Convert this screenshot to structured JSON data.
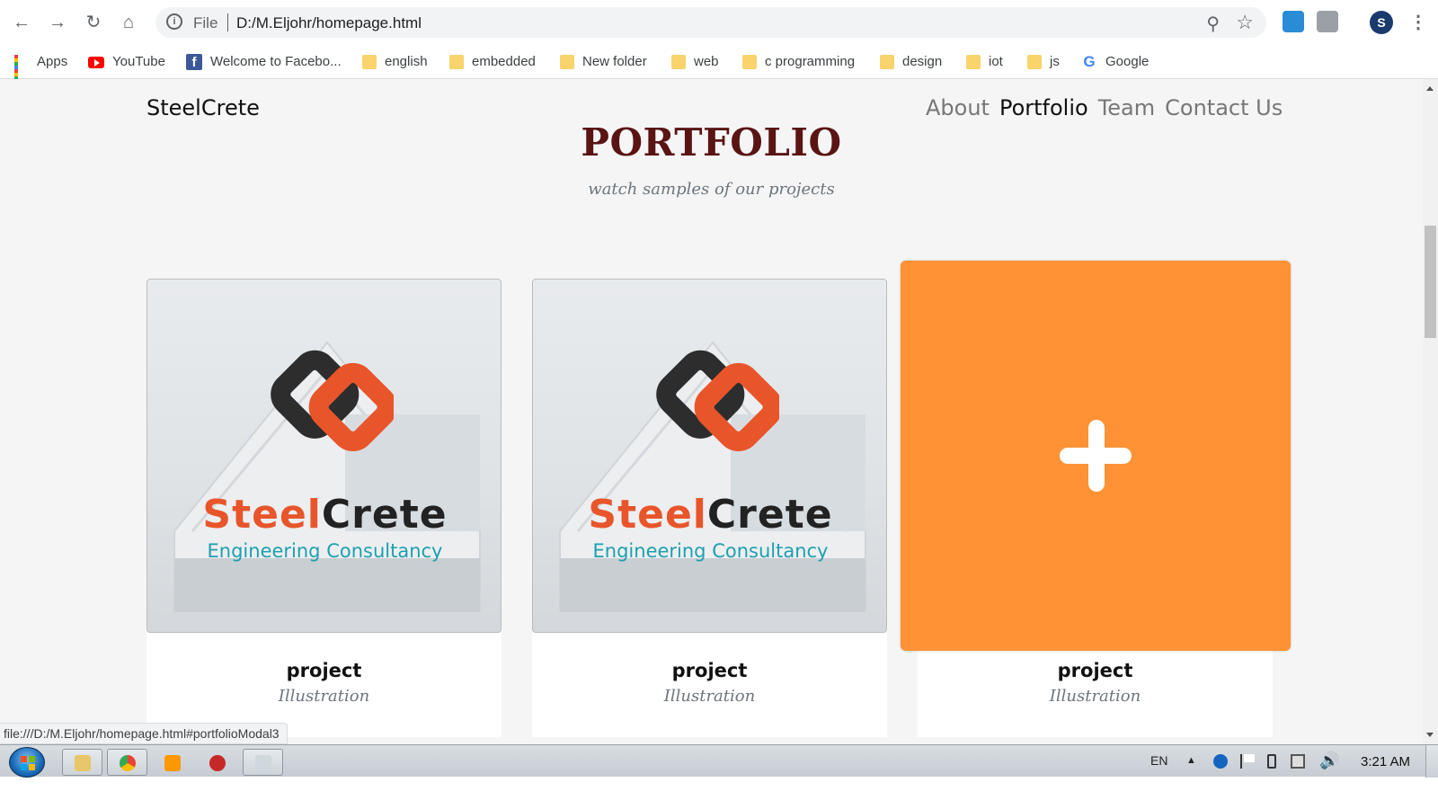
{
  "browser": {
    "scheme": "File",
    "url": "D:/M.Eljohr/homepage.html",
    "status_url": "file:///D:/M.Eljohr/homepage.html#portfolioModal3",
    "bookmarks": [
      {
        "label": "Apps",
        "icon": "apps-icon"
      },
      {
        "label": "YouTube",
        "icon": "youtube-icon"
      },
      {
        "label": "Welcome to Facebo...",
        "icon": "facebook-icon"
      },
      {
        "label": "english",
        "icon": "folder-icon"
      },
      {
        "label": "embedded",
        "icon": "folder-icon"
      },
      {
        "label": "New folder",
        "icon": "folder-icon"
      },
      {
        "label": "web",
        "icon": "folder-icon"
      },
      {
        "label": "c programming",
        "icon": "folder-icon"
      },
      {
        "label": "design",
        "icon": "folder-icon"
      },
      {
        "label": "iot",
        "icon": "folder-icon"
      },
      {
        "label": "js",
        "icon": "folder-icon"
      },
      {
        "label": "Google",
        "icon": "google-icon"
      }
    ]
  },
  "site": {
    "brand": "SteelCrete",
    "nav": [
      {
        "label": "About",
        "active": false
      },
      {
        "label": "Portfolio",
        "active": true
      },
      {
        "label": "Team",
        "active": false
      },
      {
        "label": "Contact Us",
        "active": false
      }
    ]
  },
  "portfolio": {
    "title": "PORTFOLIO",
    "subtitle": "watch samples of our projects",
    "items": [
      {
        "title": "project",
        "subtitle": "Illustration",
        "logo_word_1": "Steel",
        "logo_word_2": "Crete",
        "logo_tagline": "Engineering Consultancy",
        "hovered": false
      },
      {
        "title": "project",
        "subtitle": "Illustration",
        "logo_word_1": "Steel",
        "logo_word_2": "Crete",
        "logo_tagline": "Engineering Consultancy",
        "hovered": false
      },
      {
        "title": "project",
        "subtitle": "Illustration",
        "hovered": true
      }
    ],
    "colors": {
      "title": "#5a1414",
      "hover_overlay": "#fe9234",
      "logo_orange": "#e8552b",
      "logo_teal": "#1e9fae"
    }
  },
  "taskbar": {
    "language": "EN",
    "clock": "3:21 AM"
  }
}
